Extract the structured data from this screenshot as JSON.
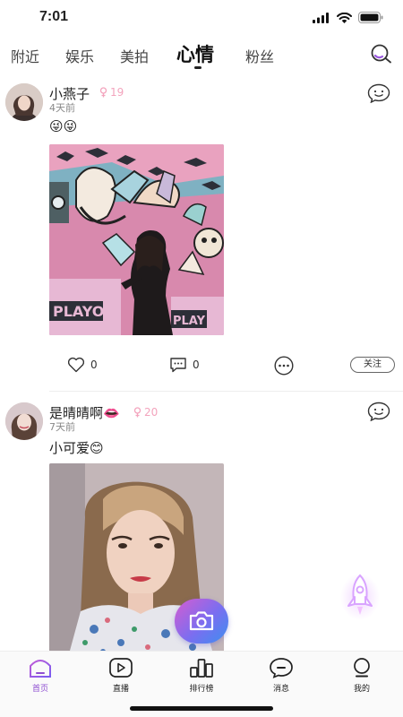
{
  "status_bar": {
    "time": "7:01"
  },
  "tabs": [
    {
      "label": "附近",
      "active": false
    },
    {
      "label": "娱乐",
      "active": false
    },
    {
      "label": "美拍",
      "active": false
    },
    {
      "label": "心情",
      "active": true
    },
    {
      "label": "粉丝",
      "active": false
    }
  ],
  "icons": {
    "search": "search-icon",
    "comment": "comment-smile-icon",
    "like": "heart-icon",
    "reply": "chat-bubble-icon",
    "more": "more-dots-icon",
    "camera": "camera-icon",
    "rocket": "rocket-icon",
    "level": "female-icon"
  },
  "colors": {
    "accent": "#8f4fd1",
    "level_pink": "#f3a4bd",
    "fab_gradient_start": "#d65cd1",
    "fab_gradient_end": "#3d8fef"
  },
  "posts": [
    {
      "user": "小燕子",
      "level": "19",
      "time": "4天前",
      "text": "😜😜",
      "likes": "0",
      "comments": "0",
      "follow_label": "关注"
    },
    {
      "user": "是晴晴啊👄",
      "level": "20",
      "time": "7天前",
      "text": "小可爱😊"
    }
  ],
  "nav": [
    {
      "label": "首页",
      "icon": "home-icon",
      "active": true
    },
    {
      "label": "直播",
      "icon": "live-play-icon",
      "active": false
    },
    {
      "label": "排行榜",
      "icon": "ranking-icon",
      "active": false
    },
    {
      "label": "消息",
      "icon": "message-icon",
      "active": false
    },
    {
      "label": "我的",
      "icon": "profile-icon",
      "active": false
    }
  ]
}
